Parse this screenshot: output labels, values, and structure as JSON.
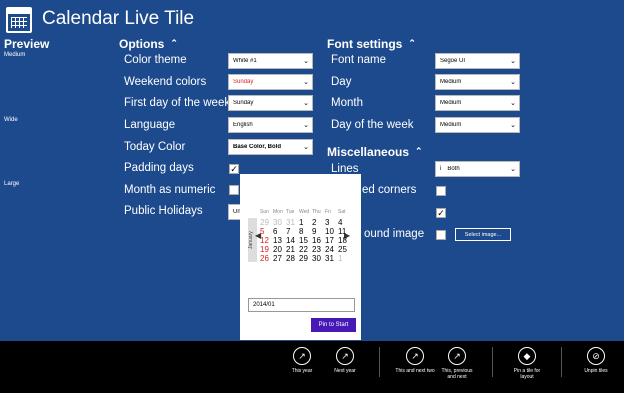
{
  "app": {
    "title": "Calendar Live Tile"
  },
  "preview": {
    "heading": "Preview",
    "sizes": [
      "Medium",
      "Wide",
      "Large"
    ]
  },
  "options": {
    "heading": "Options",
    "rows": [
      {
        "label": "Color theme",
        "value": "White #1"
      },
      {
        "label": "Weekend colors",
        "value": "Sunday"
      },
      {
        "label": "First day of the week",
        "value": "Sunday"
      },
      {
        "label": "Language",
        "value": "English"
      },
      {
        "label": "Today Color",
        "value": "Base Color, Bold"
      },
      {
        "label": "Padding days",
        "checked": true
      },
      {
        "label": "Month as numeric",
        "checked": false
      },
      {
        "label": "Public Holidays",
        "value": "Un"
      }
    ]
  },
  "font_settings": {
    "heading": "Font settings",
    "rows": [
      {
        "label": "Font name",
        "value": "Segoe UI"
      },
      {
        "label": "Day",
        "value": "Medium"
      },
      {
        "label": "Month",
        "value": "Medium"
      },
      {
        "label": "Day of the week",
        "value": "Medium"
      }
    ]
  },
  "misc": {
    "heading": "Miscellaneous",
    "rows": [
      {
        "label": "Lines",
        "value": "Both",
        "icon": "i"
      },
      {
        "label": "ed corners",
        "checked": false
      },
      {
        "label": "",
        "checked": true
      },
      {
        "label": "ound image",
        "checked": false,
        "button": "Select image..."
      }
    ]
  },
  "popup": {
    "weekdays": [
      "Sun",
      "Mon",
      "Tue",
      "Wed",
      "Thu",
      "Fri",
      "Sat"
    ],
    "month_label": "January",
    "days": [
      [
        "29",
        "30",
        "31",
        "1",
        "2",
        "3",
        "4"
      ],
      [
        "5",
        "6",
        "7",
        "8",
        "9",
        "10",
        "11"
      ],
      [
        "12",
        "13",
        "14",
        "15",
        "16",
        "17",
        "18"
      ],
      [
        "19",
        "20",
        "21",
        "22",
        "23",
        "24",
        "25"
      ],
      [
        "26",
        "27",
        "28",
        "29",
        "30",
        "31",
        "1"
      ]
    ],
    "date_value": "2014/01",
    "pin_label": "Pin to Start"
  },
  "app_bar": {
    "buttons": [
      {
        "label": "This year",
        "icon": "pin-icon"
      },
      {
        "label": "Next year",
        "icon": "pin-icon"
      },
      {
        "label": "This and next two",
        "icon": "pin-icon"
      },
      {
        "label": "This, previous and next",
        "icon": "pin-icon"
      },
      {
        "label": "Pin a tile for layout",
        "icon": "diamond-icon"
      },
      {
        "label": "Unpin tiles",
        "icon": "unpin-icon"
      }
    ]
  },
  "colors": {
    "background": "#1d4a8c",
    "accent": "#4618b6",
    "weekend": "#d61f1f",
    "app_bar": "#000000"
  }
}
